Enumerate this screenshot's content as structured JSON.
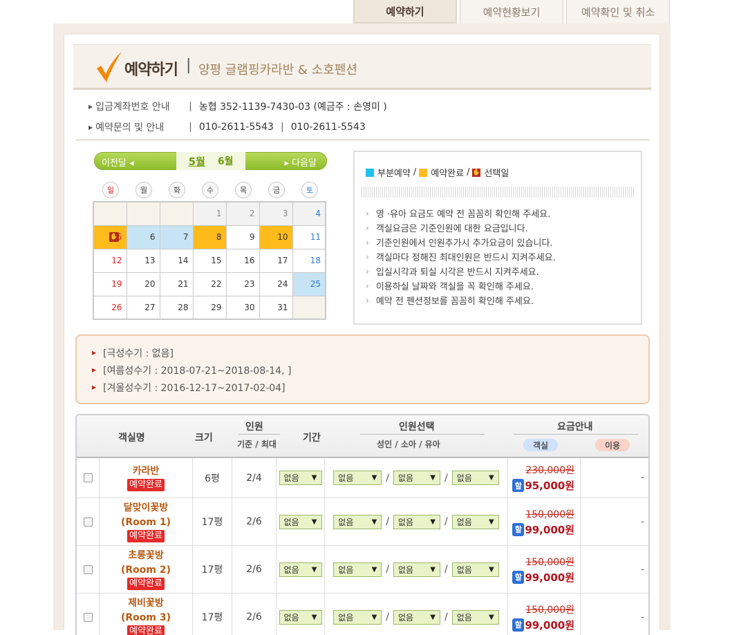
{
  "tabs": [
    {
      "label": "예약하기",
      "active": true
    },
    {
      "label": "예약현황보기",
      "active": false
    },
    {
      "label": "예약확인 및 취소",
      "active": false
    }
  ],
  "header": {
    "title": "예약하기",
    "separator": "|",
    "subtitle": "양평 글램핑카라반 & 소호펜션"
  },
  "info": {
    "account_label": "입금계좌번호 안내",
    "account_value": "농협  352-1139-7430-03 (예금주 : 손영미 )",
    "contact_label": "예약문의 및 안내",
    "phone1": "010-2611-5543",
    "phone2": "010-2611-5543"
  },
  "calendar": {
    "prev_label": "이전달",
    "next_label": "다음달",
    "current_month": "5월",
    "next_month": "6월",
    "weekdays": [
      "일",
      "월",
      "화",
      "수",
      "목",
      "금",
      "토"
    ],
    "weeks": [
      [
        {
          "d": "",
          "s": "empty"
        },
        {
          "d": "",
          "s": "empty"
        },
        {
          "d": "",
          "s": "empty"
        },
        {
          "d": "1",
          "s": "pre"
        },
        {
          "d": "2",
          "s": "pre"
        },
        {
          "d": "3",
          "s": "pre"
        },
        {
          "d": "4",
          "s": "pre sat"
        }
      ],
      [
        {
          "d": "5",
          "s": "done sun selected"
        },
        {
          "d": "6",
          "s": "partial"
        },
        {
          "d": "7",
          "s": "partial"
        },
        {
          "d": "8",
          "s": "done"
        },
        {
          "d": "9",
          "s": ""
        },
        {
          "d": "10",
          "s": "done"
        },
        {
          "d": "11",
          "s": "sat"
        }
      ],
      [
        {
          "d": "12",
          "s": "sun"
        },
        {
          "d": "13",
          "s": ""
        },
        {
          "d": "14",
          "s": ""
        },
        {
          "d": "15",
          "s": ""
        },
        {
          "d": "16",
          "s": ""
        },
        {
          "d": "17",
          "s": ""
        },
        {
          "d": "18",
          "s": "sat"
        }
      ],
      [
        {
          "d": "19",
          "s": "sun"
        },
        {
          "d": "20",
          "s": ""
        },
        {
          "d": "21",
          "s": ""
        },
        {
          "d": "22",
          "s": ""
        },
        {
          "d": "23",
          "s": ""
        },
        {
          "d": "24",
          "s": ""
        },
        {
          "d": "25",
          "s": "partial sat"
        }
      ],
      [
        {
          "d": "26",
          "s": "sun"
        },
        {
          "d": "27",
          "s": ""
        },
        {
          "d": "28",
          "s": ""
        },
        {
          "d": "29",
          "s": ""
        },
        {
          "d": "30",
          "s": ""
        },
        {
          "d": "31",
          "s": ""
        },
        {
          "d": "",
          "s": "empty"
        }
      ]
    ]
  },
  "legend": {
    "partial": "부분예약",
    "done": "예약완료",
    "selected": "선택일",
    "partial_color": "#1fc2ee",
    "done_color": "#fdbb1c"
  },
  "notes": [
    "영 ·유아 요금도 예약 전 꼼꼼히 확인해 주세요.",
    "객실요금은 기준인원에 대한 요금입니다.",
    "기준인원에서 인원추가시 추가요금이 있습니다.",
    "객실마다 정해진 최대인원은 반드시 지켜주세요.",
    "입실시각과 퇴실 시각은 반드시 지켜주세요.",
    "이용하실 날짜와 객실을 꼭 확인해 주세요.",
    "예약 전 펜션정보를 꼼꼼히 확인해 주세요."
  ],
  "seasons": [
    "[극성수기 : 없음]",
    "[여름성수기 : 2018-07-21~2018-08-14,  ]",
    "[겨울성수기 : 2016-12-17~2017-02-04]"
  ],
  "table_header": {
    "room": "객실명",
    "size": "크기",
    "people": "인원",
    "people_sub": "기준 / 최대",
    "period": "기간",
    "select": "인원선택",
    "select_sub": "성인  /  소아  /  유아",
    "price": "요금안내",
    "price_room": "객실",
    "price_use": "이용"
  },
  "rooms": [
    {
      "name1": "카라반",
      "name2": "",
      "status": "예약완료",
      "size": "6평",
      "people": "2/4",
      "period": "없음",
      "adult": "없음",
      "child": "없음",
      "infant": "없음",
      "orig": "230,000원",
      "sale_icon": "할",
      "sale": "95,000원",
      "use": "-"
    },
    {
      "name1": "달맞이꽃방",
      "name2": "(Room 1)",
      "status": "예약완료",
      "size": "17평",
      "people": "2/6",
      "period": "없음",
      "adult": "없음",
      "child": "없음",
      "infant": "없음",
      "orig": "150,000원",
      "sale_icon": "할",
      "sale": "99,000원",
      "use": "-"
    },
    {
      "name1": "초롱꽃방",
      "name2": "(Room 2)",
      "status": "예약완료",
      "size": "17평",
      "people": "2/6",
      "period": "없음",
      "adult": "없음",
      "child": "없음",
      "infant": "없음",
      "orig": "150,000원",
      "sale_icon": "할",
      "sale": "99,000원",
      "use": "-"
    },
    {
      "name1": "제비꽃방",
      "name2": "(Room 3)",
      "status": "예약완료",
      "size": "17평",
      "people": "2/6",
      "period": "없음",
      "adult": "없음",
      "child": "없음",
      "infant": "없음",
      "orig": "150,000원",
      "sale_icon": "할",
      "sale": "99,000원",
      "use": "-"
    }
  ]
}
